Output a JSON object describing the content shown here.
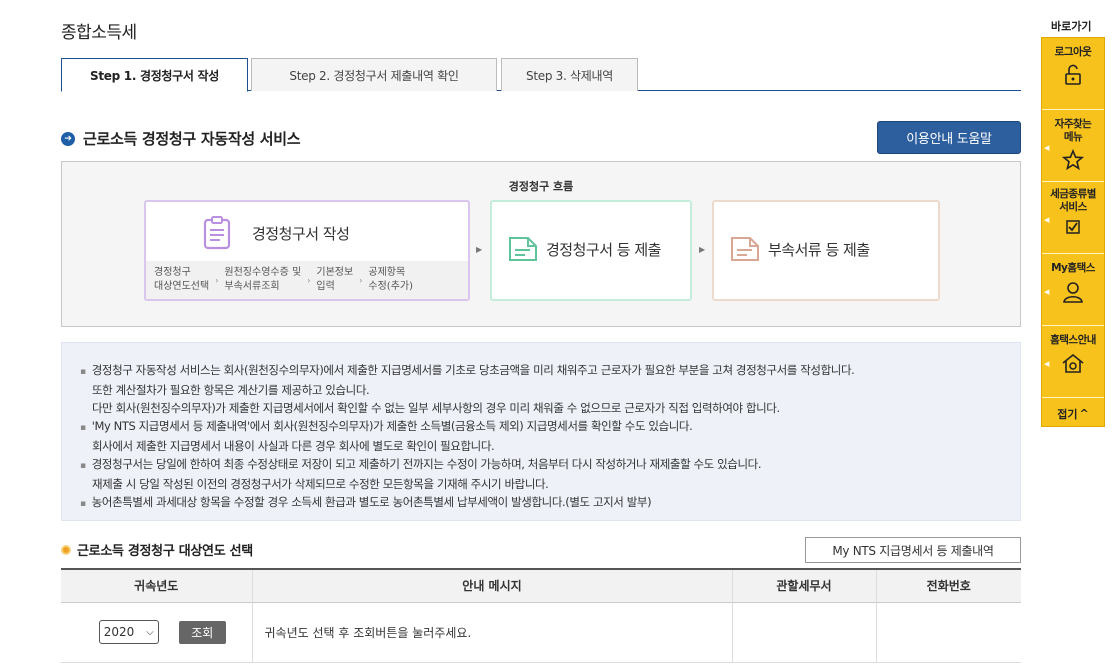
{
  "page": {
    "title": "종합소득세"
  },
  "tabs": [
    {
      "label": "Step 1. 경정청구서 작성",
      "active": true
    },
    {
      "label": "Step 2. 경정청구서 제출내역 확인",
      "active": false
    },
    {
      "label": "Step 3. 삭제내역",
      "active": false
    }
  ],
  "service": {
    "title": "근로소득 경정청구 자동작성 서비스",
    "help_button": "이용안내 도움말"
  },
  "flow": {
    "label": "경정청구 흐름",
    "step1": {
      "title": "경정청구서 작성",
      "substeps": [
        {
          "line1": "경정청구",
          "line2": "대상연도선택"
        },
        {
          "line1": "원천징수영수증 및",
          "line2": "부속서류조회"
        },
        {
          "line1": "기본정보",
          "line2": "입력"
        },
        {
          "line1": "공제항목",
          "line2": "수정(추가)"
        }
      ]
    },
    "step2": {
      "title": "경정청구서 등 제출"
    },
    "step3": {
      "title": "부속서류 등 제출"
    }
  },
  "info": {
    "lines": [
      {
        "text": "경정청구 자동작성 서비스는 회사(원천징수의무자)에서 제출한 지급명세서를 기초로 당초금액을 미리 채워주고 근로자가 필요한 부분을 고쳐 경정청구서를 작성합니다.",
        "bullet": true
      },
      {
        "text": "또한 계산절차가 필요한 항목은 계산기를 제공하고 있습니다.",
        "bullet": false
      },
      {
        "text": "다만 회사(원천징수의무자)가 제출한 지급명세서에서 확인할 수 없는 일부 세부사항의 경우 미리 채워줄 수 없으므로 근로자가 직접 입력하여야 합니다.",
        "bullet": false
      },
      {
        "text": "'My NTS 지급명세서 등 제출내역'에서 회사(원천징수의무자)가 제출한 소득별(금융소득 제외) 지급명세서를 확인할 수도 있습니다.",
        "bullet": true
      },
      {
        "text": "회사에서 제출한 지급명세서 내용이 사실과 다른 경우 회사에 별도로 확인이 필요합니다.",
        "bullet": false
      },
      {
        "text": "경정청구서는 당일에 한하여 최종 수정상태로 저장이 되고 제출하기 전까지는 수정이 가능하며, 처음부터 다시 작성하거나 재제출할 수도 있습니다.",
        "bullet": true
      },
      {
        "text": "재제출 시 당일 작성된 이전의 경정청구서가 삭제되므로 수정한 모든항목을 기재해 주시기 바랍니다.",
        "bullet": false
      },
      {
        "text": "농어촌특별세 과세대상 항목을 수정할 경우 소득세 환급과 별도로 농어촌특별세 납부세액이 발생합니다.(별도 고지서 발부)",
        "bullet": true
      }
    ]
  },
  "year_section": {
    "title": "근로소득 경정청구 대상연도 선택",
    "nts_button": "My NTS 지급명세서 등 제출내역",
    "table": {
      "headers": [
        "귀속년도",
        "안내 메시지",
        "관할세무서",
        "전화번호"
      ],
      "row": {
        "year": "2020",
        "search_button": "조회",
        "message": "귀속년도 선택 후 조회버튼을 눌러주세요.",
        "office": "",
        "phone": ""
      }
    }
  },
  "quick_menu": {
    "label": "바로가기",
    "items": [
      "로그아웃",
      "자주찾는 메뉴",
      "세금종류별 서비스",
      "My홈택스",
      "홈택스안내"
    ],
    "fold": "접기"
  },
  "colors": {
    "accent": "#1f5fa8",
    "quick_bg": "#f8c21c",
    "card1_border": "#d9c6ee",
    "card2_border": "#c6ecdb",
    "card3_border": "#ecdacd"
  }
}
